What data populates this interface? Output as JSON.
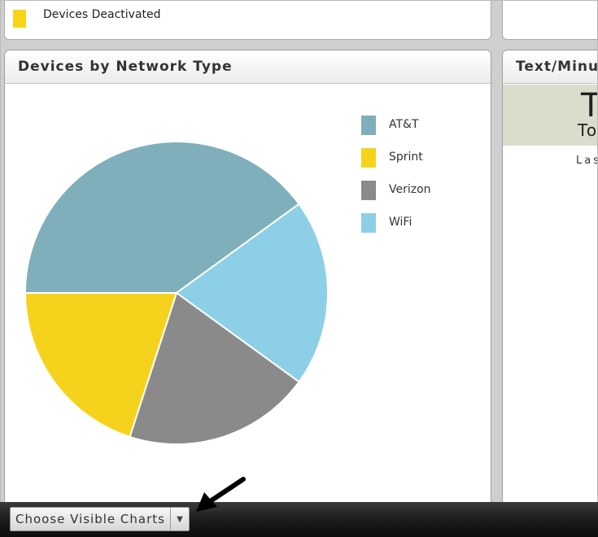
{
  "top_legend": {
    "label": "Devices Deactivated",
    "color": "#f7d417"
  },
  "left_panel": {
    "title": "Devices by Network Type"
  },
  "right_panel": {
    "title": "Text/Minu",
    "big_char": "T",
    "sub_text": "To",
    "note": "Las"
  },
  "chart_data": {
    "type": "pie",
    "slices": [
      {
        "label": "AT&T",
        "value": 40,
        "color": "#7fafbb"
      },
      {
        "label": "WiFi",
        "value": 20,
        "color": "#8dcfe6"
      },
      {
        "label": "Verizon",
        "value": 20,
        "color": "#8a8a8a"
      },
      {
        "label": "Sprint",
        "value": 20,
        "color": "#f5d31c"
      }
    ],
    "legend_order": [
      "AT&T",
      "Sprint",
      "Verizon",
      "WiFi"
    ],
    "legend_position": "right"
  },
  "toolbar": {
    "choose_label": "Choose Visible Charts",
    "dropdown_icon": "chevron-down-icon"
  },
  "annotation": {
    "arrow_icon": "pointer-arrow-icon",
    "arrow_color": "#000000"
  }
}
